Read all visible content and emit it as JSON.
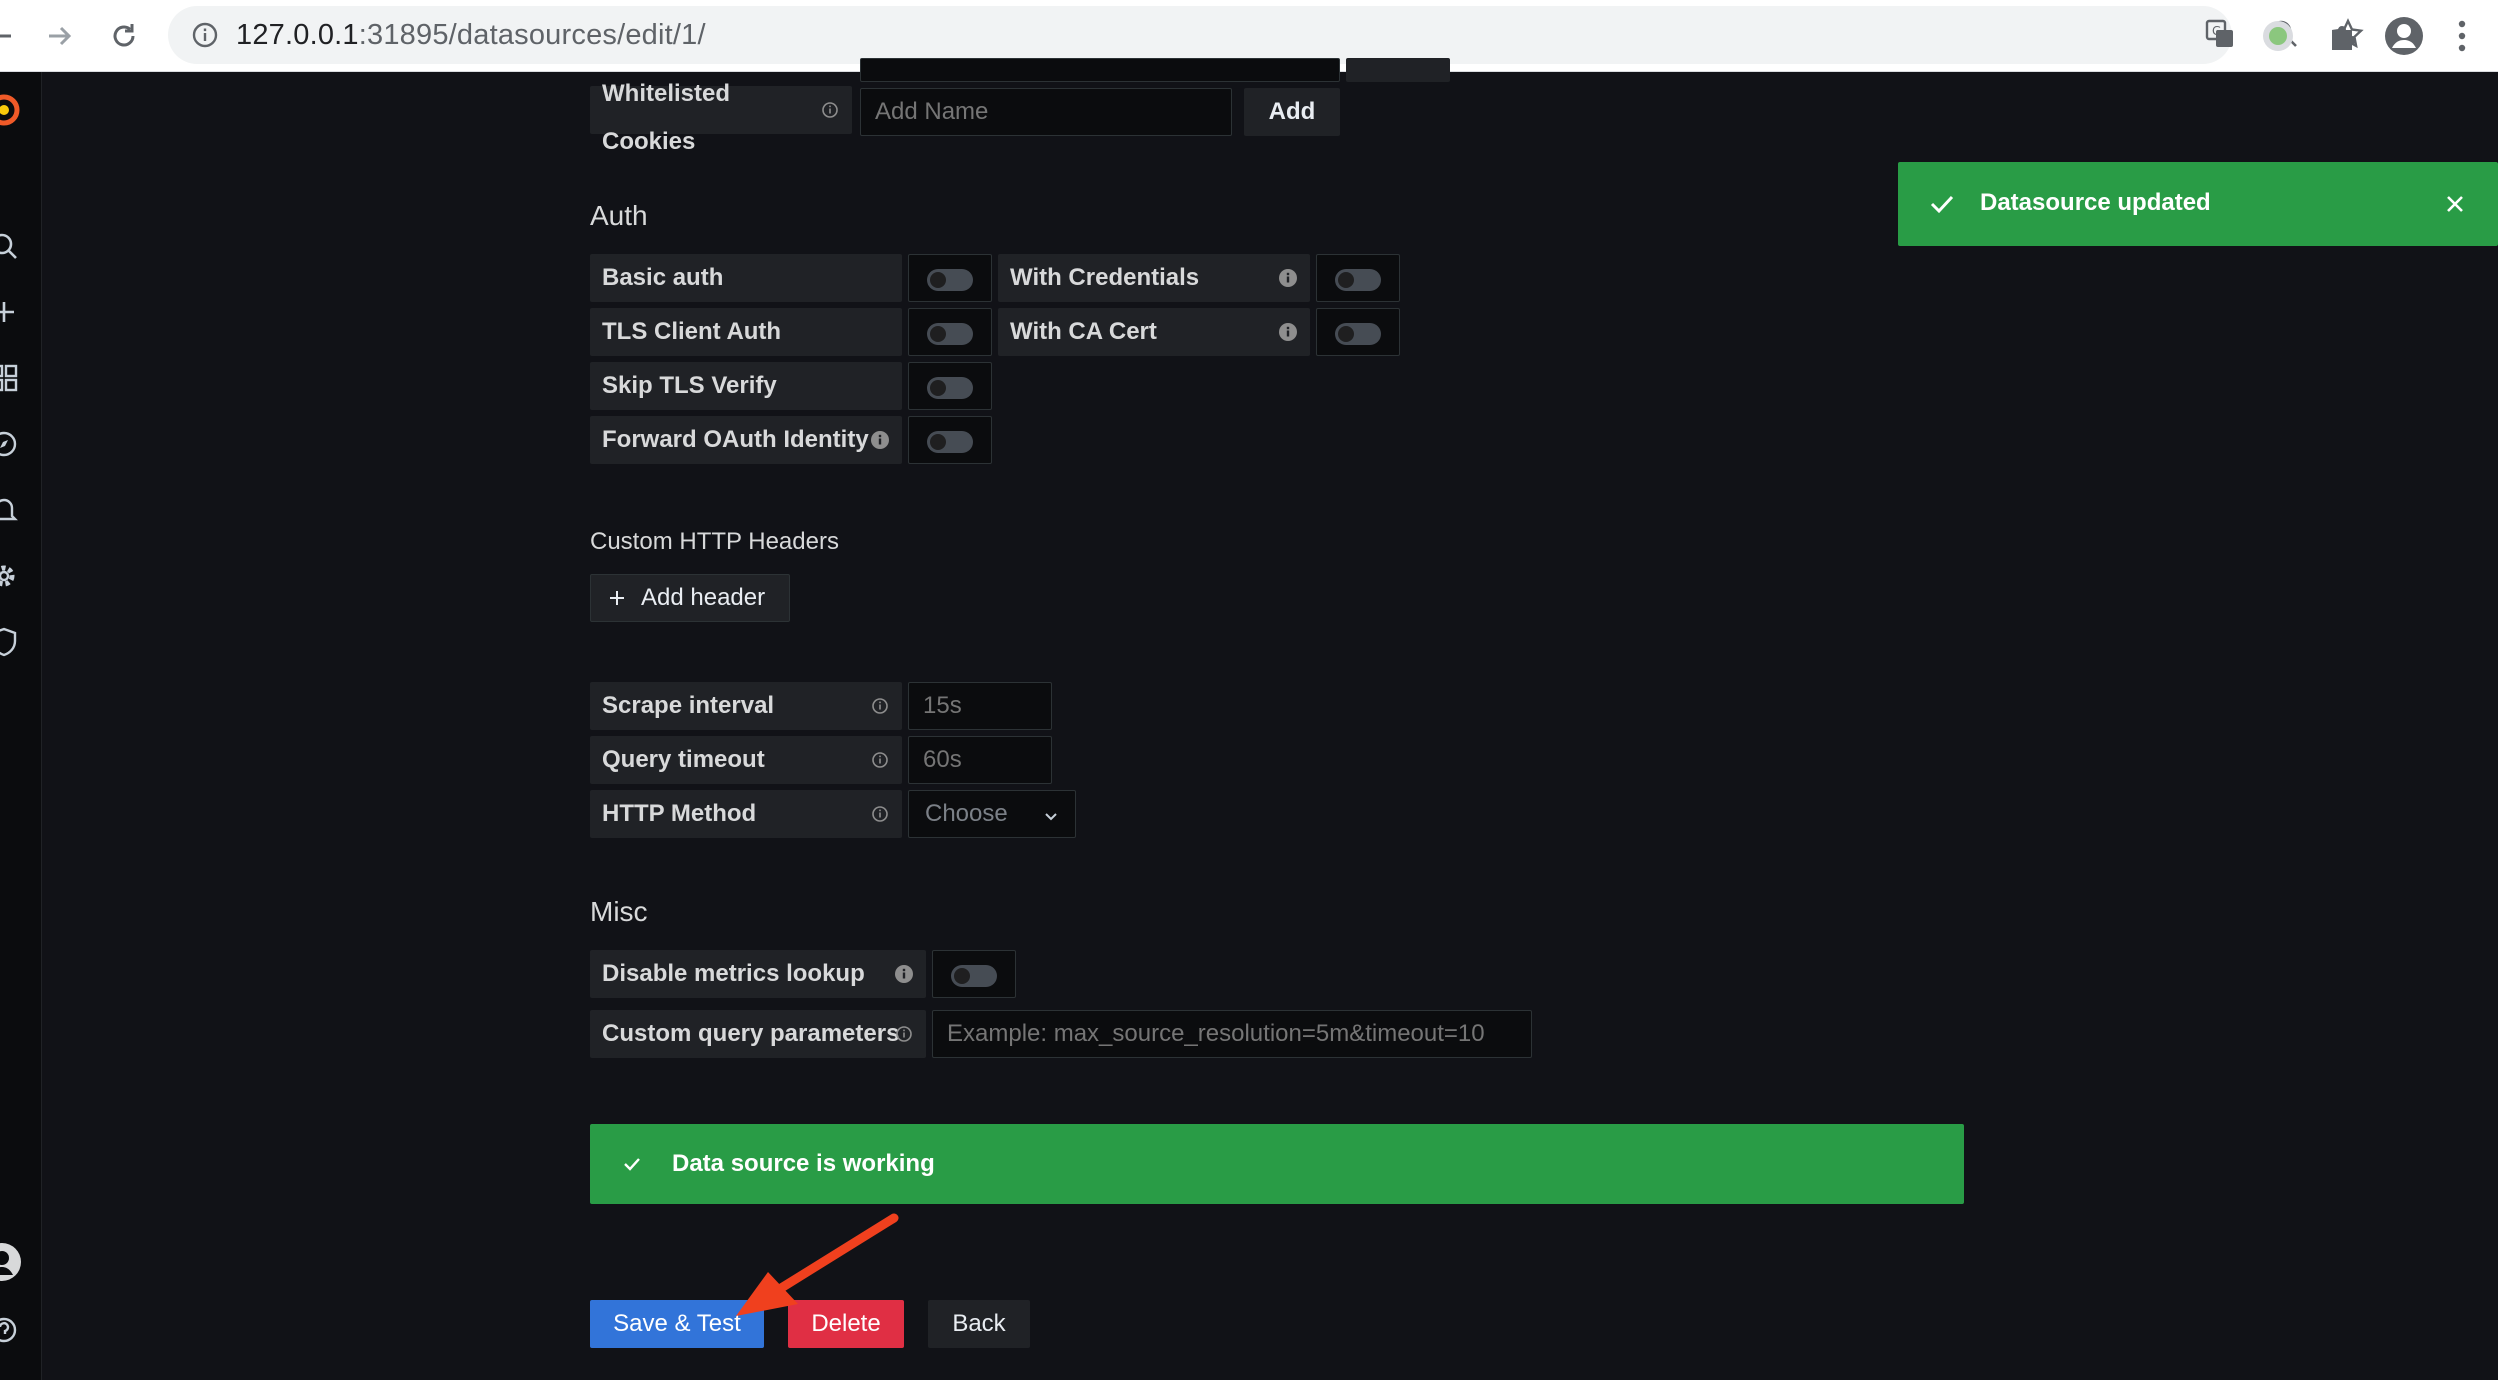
{
  "browser": {
    "url_host": "127.0.0.1",
    "url_rest": ":31895/datasources/edit/1/"
  },
  "cookies": {
    "label_line1": "Whitelisted",
    "label_line2": "Cookies",
    "placeholder": "Add Name",
    "add_label": "Add"
  },
  "auth": {
    "title": "Auth",
    "basic_auth": "Basic auth",
    "with_credentials": "With Credentials",
    "tls_client_auth": "TLS Client Auth",
    "with_ca_cert": "With CA Cert",
    "skip_tls_verify": "Skip TLS Verify",
    "forward_oauth": "Forward OAuth Identity"
  },
  "headers": {
    "title": "Custom HTTP Headers",
    "add_header": "Add header"
  },
  "prometheus": {
    "scrape_interval_label": "Scrape interval",
    "scrape_interval_placeholder": "15s",
    "query_timeout_label": "Query timeout",
    "query_timeout_placeholder": "60s",
    "http_method_label": "HTTP Method",
    "http_method_value": "Choose"
  },
  "misc": {
    "title": "Misc",
    "disable_metrics_lookup": "Disable metrics lookup",
    "custom_query_params": "Custom query parameters",
    "custom_query_placeholder": "Example: max_source_resolution=5m&timeout=10"
  },
  "status": {
    "working": "Data source is working",
    "toast": "Datasource updated"
  },
  "actions": {
    "save_test": "Save & Test",
    "delete": "Delete",
    "back": "Back"
  },
  "colors": {
    "success": "#299c46",
    "primary": "#3274d9",
    "danger": "#e02f44",
    "annotation_arrow": "#f0401e"
  }
}
